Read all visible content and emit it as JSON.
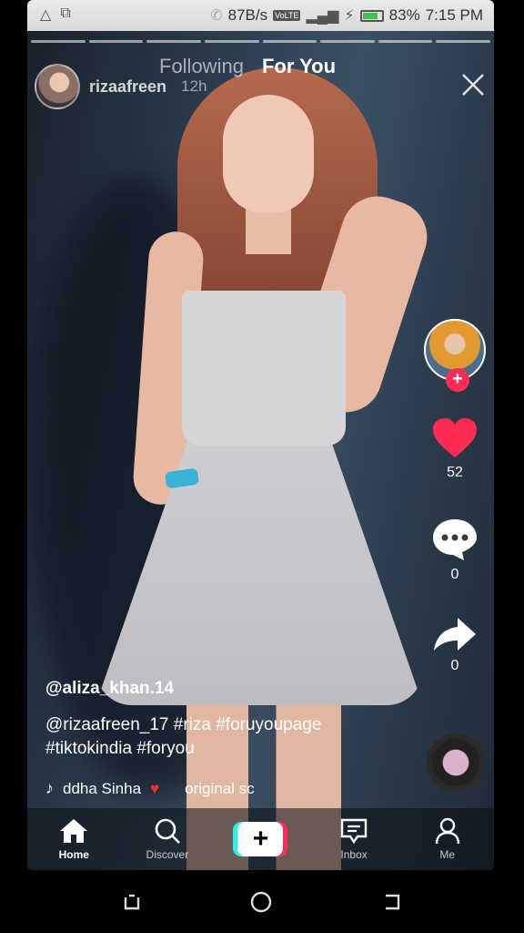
{
  "status_bar": {
    "left_icons": [
      "warning-icon",
      "cast-icon"
    ],
    "network_speed": "87B/s",
    "volte": "VoLTE",
    "battery_percent": "83%",
    "time": "7:15 PM",
    "battery_level": 0.83
  },
  "author": {
    "name": "rizaafreen",
    "time": "12h"
  },
  "feed_tabs": {
    "following": "Following",
    "for_you": "For You",
    "active": "For You"
  },
  "actions": {
    "likes": "52",
    "comments": "0",
    "shares": "0"
  },
  "caption": {
    "username": "@aliza_khan.14",
    "text_line1": "@rizaafreen_17 #riza #foruyoupage",
    "text_line2": "#tiktokindia #foryou",
    "music": "ddha Sinha",
    "music_suffix": "original sc"
  },
  "bottom_nav": {
    "home": "Home",
    "discover": "Discover",
    "add": "+",
    "inbox": "Inbox",
    "me": "Me",
    "active": "Home"
  },
  "colors": {
    "accent_red": "#fe2c55",
    "accent_cyan": "#25f4ee",
    "like_red": "#fe2c55"
  }
}
